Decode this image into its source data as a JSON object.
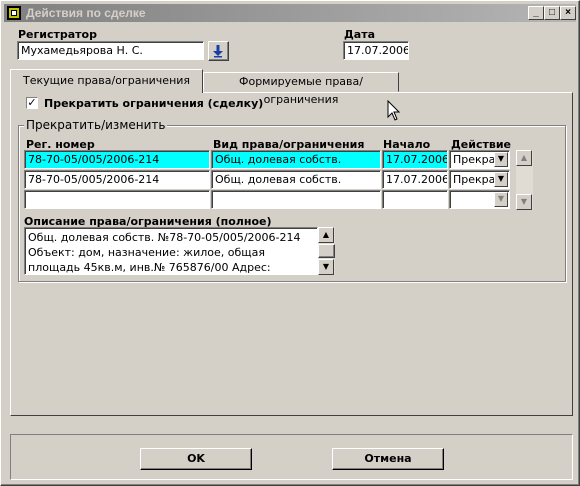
{
  "window": {
    "title": "Действия по сделке",
    "controls": {
      "minimize": "_",
      "maximize": "□",
      "close": "×"
    }
  },
  "header": {
    "registrar_label": "Регистратор",
    "registrar_value": "Мухамедьярова Н. С.",
    "date_label": "Дата",
    "date_value": "17.07.2006"
  },
  "tabs": [
    {
      "label": "Текущие права/ограничения",
      "active": true
    },
    {
      "label": "Формируемые права/ограничения",
      "active": false
    }
  ],
  "terminate_checkbox": {
    "label": "Прекратить ограничения (сделку)",
    "checked": true,
    "mark": "✓"
  },
  "group": {
    "title": "Прекратить/изменить",
    "columns": [
      "Рег. номер",
      "Вид права/ограничения",
      "Начало",
      "Действие"
    ],
    "rows": [
      {
        "reg": "78-70-05/005/2006-214",
        "kind": "Общ. долевая собств.",
        "start": "17.07.2006",
        "action": "Прекрати",
        "selected": true
      },
      {
        "reg": "78-70-05/005/2006-214",
        "kind": "Общ. долевая собств.",
        "start": "17.07.2006",
        "action": "Прекрати",
        "selected": false
      },
      {
        "reg": "",
        "kind": "",
        "start": "",
        "action": "",
        "selected": false
      }
    ]
  },
  "description": {
    "label": "Описание права/ограничения (полное)",
    "text": "Общ. долевая собств. №78-70-05/005/2006-214 Объект: дом, назначение: жилое, общая площадь 45кв.м, инв.№ 765876/00 Адрес: Ленинградская область,"
  },
  "buttons": {
    "ok": "OK",
    "cancel": "Отмена"
  },
  "colors": {
    "selected_row": "#00ffff",
    "face": "#d4d0c8",
    "titlebar_inactive": "#808080"
  },
  "icons": {
    "app": "app-icon",
    "lookup": "arrow-down-icon"
  }
}
